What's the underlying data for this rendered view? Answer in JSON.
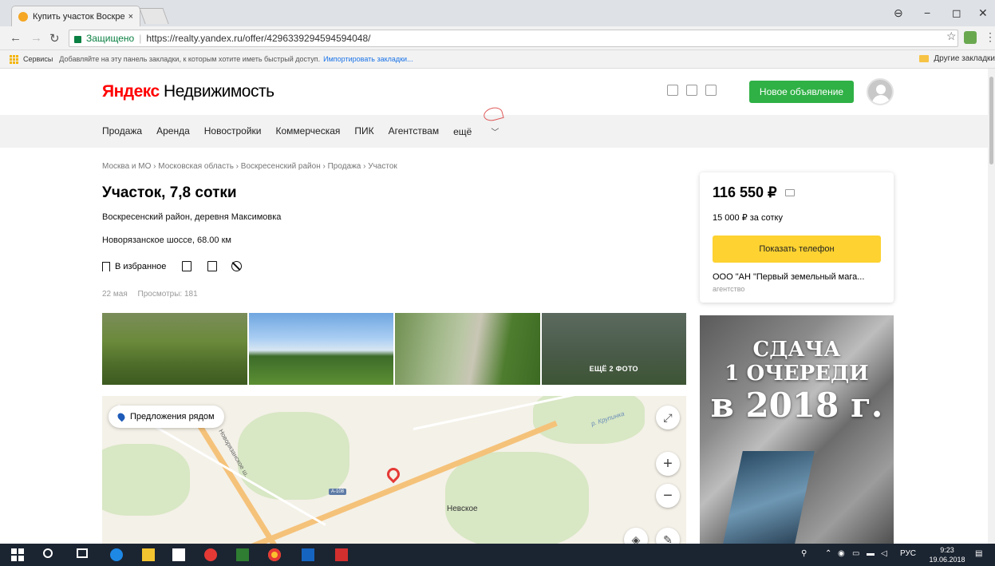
{
  "browser": {
    "tab_title": "Купить участок Воскрес",
    "tab_close": "×",
    "secure_label": "Защищено",
    "url": "https://realty.yandex.ru/offer/4296339294594594048/",
    "controls": {
      "minimize": "−",
      "maximize": "◻",
      "close": "✕"
    },
    "bookmarks": {
      "apps_label": "Сервисы",
      "hint": "Добавляйте на эту панель закладки, к которым хотите иметь быстрый доступ.",
      "import_link": "Импортировать закладки...",
      "other": "Другие закладки"
    }
  },
  "header": {
    "logo_brand": "Яндекс",
    "logo_service": "Недвижимость",
    "new_ad_button": "Новое объявление"
  },
  "nav": {
    "items": [
      "Продажа",
      "Аренда",
      "Новостройки",
      "Коммерческая",
      "ПИК",
      "Агентствам"
    ],
    "more": "ещё"
  },
  "offer": {
    "breadcrumb": "Москва и МО › Московская область › Воскресенский район › Продажа › Участок",
    "title": "Участок, 7,8 сотки",
    "address": "Воскресенский район, деревня Максимовка",
    "highway": "Новорязанское шоссе, 68.00 км",
    "favorite": "В избранное",
    "date": "22 мая",
    "views": "Просмотры: 181",
    "more_photos": "ЕЩЁ 2 ФОТО"
  },
  "map": {
    "nearby_button": "Предложения рядом",
    "village": "Невское",
    "river": "р. Крупинка",
    "road_name": "Новорязанское ш.",
    "road_shield": "А-108",
    "zoom_in": "+",
    "zoom_out": "−"
  },
  "price_card": {
    "price": "116 550 ₽",
    "per_sotka": "15 000 ₽ за сотку",
    "phone_button": "Показать телефон",
    "agency": "ООО \"АН \"Первый земельный мага...",
    "agency_type": "агентство"
  },
  "banner": {
    "line1": "СДАЧА",
    "line2": "1 ОЧЕРЕДИ",
    "line3": "в 2018 г."
  },
  "taskbar": {
    "lang": "РУС",
    "time": "9:23",
    "date": "19.06.2018"
  }
}
